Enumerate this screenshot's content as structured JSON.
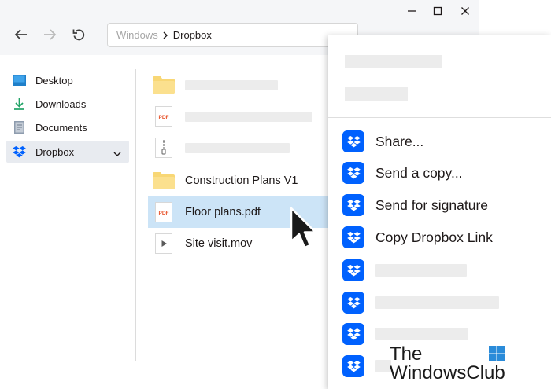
{
  "address_bar": {
    "root": "Windows",
    "current": "Dropbox"
  },
  "sidebar": {
    "items": [
      {
        "label": "Desktop",
        "icon": "desktop-icon"
      },
      {
        "label": "Downloads",
        "icon": "download-icon"
      },
      {
        "label": "Documents",
        "icon": "document-icon"
      },
      {
        "label": "Dropbox",
        "icon": "dropbox-icon",
        "selected": true
      }
    ]
  },
  "files": {
    "rows": [
      {
        "name": "",
        "icon": "folder-icon",
        "placeholder": true
      },
      {
        "name": "",
        "icon": "pdf-icon",
        "placeholder": true
      },
      {
        "name": "",
        "icon": "zip-icon",
        "placeholder": true
      },
      {
        "name": "Construction Plans V1",
        "icon": "folder-icon"
      },
      {
        "name": "Floor plans.pdf",
        "icon": "pdf-icon",
        "selected": true
      },
      {
        "name": "Site visit.mov",
        "icon": "video-icon"
      }
    ],
    "pdf_badge": "PDF"
  },
  "context_menu": {
    "items": [
      {
        "label": "Share...",
        "icon": "dropbox-icon"
      },
      {
        "label": "Send a copy...",
        "icon": "dropbox-icon"
      },
      {
        "label": "Send for signature",
        "icon": "dropbox-icon"
      },
      {
        "label": "Copy Dropbox Link",
        "icon": "dropbox-icon"
      },
      {
        "label": "",
        "icon": "dropbox-icon",
        "placeholder": true
      },
      {
        "label": "",
        "icon": "dropbox-icon",
        "placeholder": true
      },
      {
        "label": "",
        "icon": "dropbox-icon",
        "placeholder": true
      },
      {
        "label": "",
        "icon": "dropbox-icon",
        "placeholder": true
      }
    ]
  },
  "watermark": {
    "line1": "The",
    "line2": "WindowsClub"
  },
  "colors": {
    "dropbox_blue": "#0061fe",
    "selection_blue": "#cce4f7",
    "folder_yellow": "#f8d775",
    "pdf_red": "#e8532b",
    "download_green": "#21a366"
  }
}
